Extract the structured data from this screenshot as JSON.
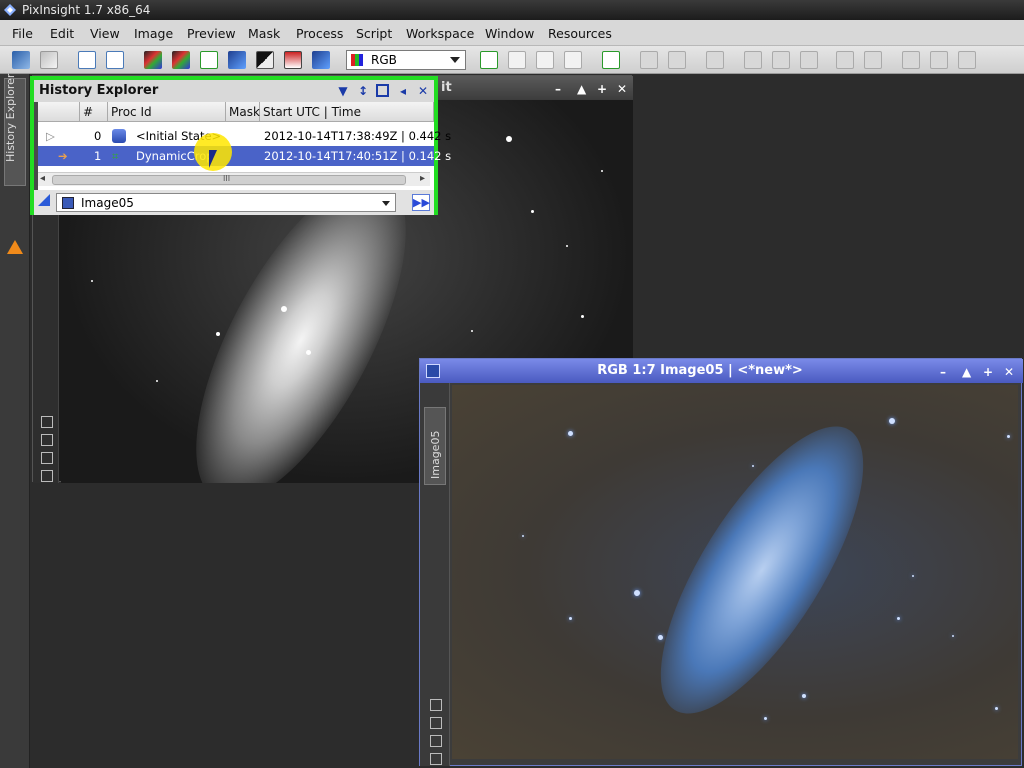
{
  "app": {
    "title": "PixInsight 1.7 x86_64"
  },
  "menu": [
    "File",
    "Edit",
    "View",
    "Image",
    "Preview",
    "Mask",
    "Process",
    "Script",
    "Workspace",
    "Window",
    "Resources"
  ],
  "toolbar": {
    "channel_select": "RGB"
  },
  "left_dock": {
    "tab_label": "History Explorer"
  },
  "history": {
    "title": "History Explorer",
    "columns": [
      "#",
      "Proc Id",
      "Mask",
      "Start UTC | Time"
    ],
    "rows": [
      {
        "index": "0",
        "proc_id": "<Initial State>",
        "mask": "",
        "start": "2012-10-14T17:38:49Z | 0.442 s",
        "selected": false
      },
      {
        "index": "1",
        "proc_id": "DynamicCrop",
        "mask": "",
        "start": "2012-10-14T17:40:51Z | 0.142 s",
        "selected": true
      }
    ],
    "scroll_label": "III",
    "image_select": "Image05"
  },
  "gray_window": {
    "title_fragment": "it"
  },
  "rgb_window": {
    "title": "RGB 1:7 Image05 | <*new*>",
    "side_tab": "Image05"
  },
  "colors": {
    "highlight_border": "#22dd22",
    "selection": "#4a63c8",
    "rgb_window_header": "#5a6ad0"
  }
}
